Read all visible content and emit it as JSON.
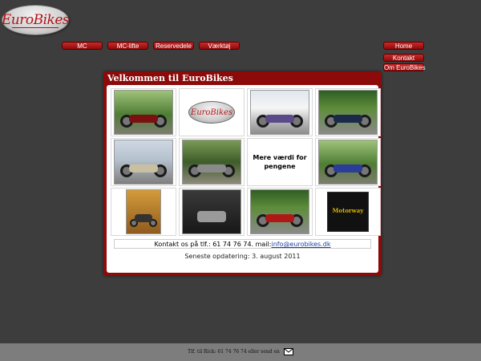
{
  "site": {
    "logo_text": "EuroBikes"
  },
  "nav_left": [
    "MC",
    "MC-lifte",
    "Reservedele",
    "Værktøj"
  ],
  "nav_right": [
    "Home",
    "Kontakt",
    "Om EuroBikes"
  ],
  "panel": {
    "title": "Velkommen til EuroBikes",
    "logo_text": "EuroBikes",
    "text_cell": "Mere værdi for pengene",
    "badge_text": "Motorway"
  },
  "contact": {
    "text": "Kontakt os på tlf.: 61 74 76 74. mail:",
    "email": "info@eurobikes.dk"
  },
  "update_text": "Seneste opdatering: 3. august 2011",
  "footer": {
    "text": "Tlf. til Rick: 61 74 76 74 eller send en"
  },
  "icons": [
    "mail-icon"
  ]
}
